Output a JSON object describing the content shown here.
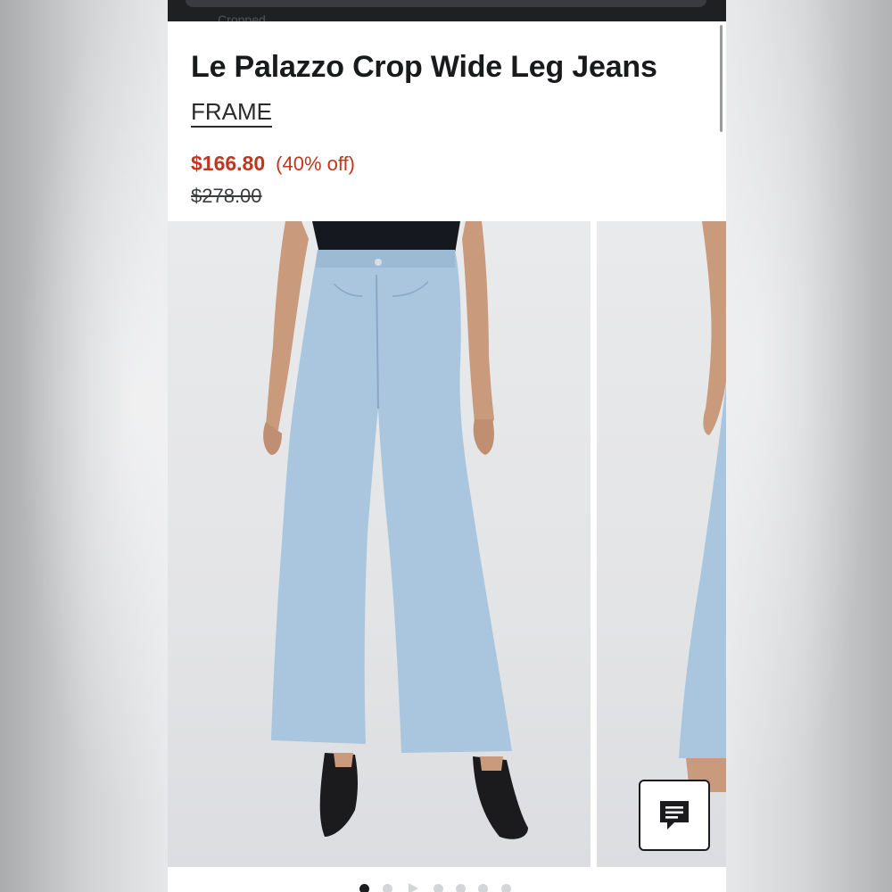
{
  "breadcrumb": {
    "label": "Cropped"
  },
  "product": {
    "title": "Le Palazzo Crop Wide Leg Jeans",
    "brand": "FRAME",
    "sale_price": "$166.80",
    "discount": "(40% off)",
    "original_price": "$278.00"
  },
  "colors": {
    "sale": "#c0361f",
    "denim": "#a9c6de",
    "background": "#ffffff"
  },
  "icons": {
    "chat": "chat-bubble-icon",
    "breadcrumb_chevron": "chevron-down-icon"
  },
  "carousel": {
    "slide_count": 7,
    "active_index": 0,
    "video_slide_index": 2
  }
}
